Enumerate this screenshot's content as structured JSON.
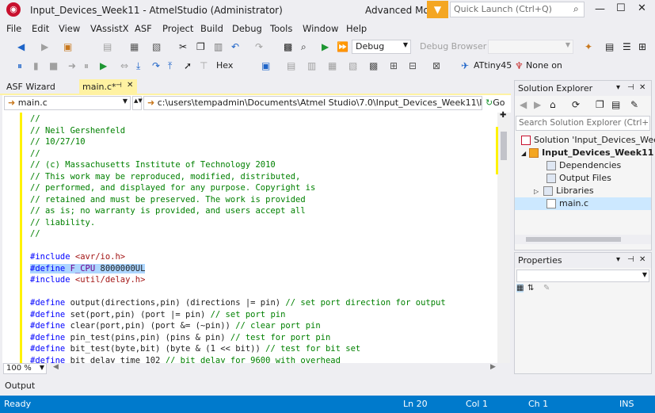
{
  "window": {
    "title": "Input_Devices_Week11 - AtmelStudio (Administrator)",
    "mode": "Advanced Mode",
    "quick_launch_placeholder": "Quick Launch (Ctrl+Q)"
  },
  "menu": [
    "File",
    "Edit",
    "View",
    "VAssistX",
    "ASF",
    "Project",
    "Build",
    "Debug",
    "Tools",
    "Window",
    "Help"
  ],
  "toolbar": {
    "config": "Debug",
    "debug_browser": "Debug Browser",
    "hex_label": "Hex",
    "device": "ATtiny45",
    "tool": "None on"
  },
  "tabs": {
    "asf_wizard": "ASF Wizard",
    "main": "main.c*"
  },
  "nav": {
    "file": "main.c",
    "path": "c:\\users\\tempadmin\\Documents\\Atmel Studio\\7.0\\Input_Devices_Week11\\Input_Devices",
    "go": "Go"
  },
  "code": [
    {
      "parts": [
        {
          "c": "cmt",
          "t": "//"
        }
      ]
    },
    {
      "parts": [
        {
          "c": "cmt",
          "t": "// Neil Gershenfeld"
        }
      ]
    },
    {
      "parts": [
        {
          "c": "cmt",
          "t": "// 10/27/10"
        }
      ]
    },
    {
      "parts": [
        {
          "c": "cmt",
          "t": "//"
        }
      ]
    },
    {
      "parts": [
        {
          "c": "cmt",
          "t": "// (c) Massachusetts Institute of Technology 2010"
        }
      ]
    },
    {
      "parts": [
        {
          "c": "cmt",
          "t": "// This work may be reproduced, modified, distributed,"
        }
      ]
    },
    {
      "parts": [
        {
          "c": "cmt",
          "t": "// performed, and displayed for any purpose. Copyright is"
        }
      ]
    },
    {
      "parts": [
        {
          "c": "cmt",
          "t": "// retained and must be preserved. The work is provided"
        }
      ]
    },
    {
      "parts": [
        {
          "c": "cmt",
          "t": "// as is; no warranty is provided, and users accept all"
        }
      ]
    },
    {
      "parts": [
        {
          "c": "cmt",
          "t": "// liability."
        }
      ]
    },
    {
      "parts": [
        {
          "c": "cmt",
          "t": "//"
        }
      ]
    },
    {
      "parts": [
        {
          "c": "",
          "t": ""
        }
      ]
    },
    {
      "parts": [
        {
          "c": "kw",
          "t": "#include "
        },
        {
          "c": "str",
          "t": "<avr/io.h>"
        }
      ]
    },
    {
      "parts": [
        {
          "c": "kw sel",
          "t": "#define "
        },
        {
          "c": "mac sel",
          "t": "F_CPU"
        },
        {
          "c": "sel",
          "t": " 8000000UL"
        }
      ]
    },
    {
      "parts": [
        {
          "c": "kw",
          "t": "#include "
        },
        {
          "c": "str",
          "t": "<util/delay.h>"
        }
      ]
    },
    {
      "parts": [
        {
          "c": "",
          "t": ""
        }
      ]
    },
    {
      "parts": [
        {
          "c": "kw",
          "t": "#define "
        },
        {
          "c": "",
          "t": "output(directions,pin) (directions |= pin) "
        },
        {
          "c": "cmt",
          "t": "// set port direction for output"
        }
      ]
    },
    {
      "parts": [
        {
          "c": "kw",
          "t": "#define "
        },
        {
          "c": "",
          "t": "set(port,pin) (port |= pin) "
        },
        {
          "c": "cmt",
          "t": "// set port pin"
        }
      ]
    },
    {
      "parts": [
        {
          "c": "kw",
          "t": "#define "
        },
        {
          "c": "",
          "t": "clear(port,pin) (port &= (~pin)) "
        },
        {
          "c": "cmt",
          "t": "// clear port pin"
        }
      ]
    },
    {
      "parts": [
        {
          "c": "kw",
          "t": "#define "
        },
        {
          "c": "",
          "t": "pin_test(pins,pin) (pins & pin) "
        },
        {
          "c": "cmt",
          "t": "// test for port pin"
        }
      ]
    },
    {
      "parts": [
        {
          "c": "kw",
          "t": "#define "
        },
        {
          "c": "",
          "t": "bit_test(byte,bit) (byte & (1 << bit)) "
        },
        {
          "c": "cmt",
          "t": "// test for bit set"
        }
      ]
    },
    {
      "parts": [
        {
          "c": "kw",
          "t": "#define "
        },
        {
          "c": "",
          "t": "bit_delay_time 102 "
        },
        {
          "c": "cmt",
          "t": "// bit delay for 9600 with overhead"
        }
      ]
    }
  ],
  "zoom": "100 %",
  "output_label": "Output",
  "status": {
    "ready": "Ready",
    "ln": "Ln 20",
    "col": "Col 1",
    "ch": "Ch 1",
    "ins": "INS"
  },
  "solution_explorer": {
    "title": "Solution Explorer",
    "search_placeholder": "Search Solution Explorer (Ctrl+",
    "items": [
      {
        "label": "Solution 'Input_Devices_Week11'"
      },
      {
        "label": "Input_Devices_Week11"
      },
      {
        "label": "Dependencies"
      },
      {
        "label": "Output Files"
      },
      {
        "label": "Libraries"
      },
      {
        "label": "main.c"
      }
    ]
  },
  "properties": {
    "title": "Properties"
  },
  "icons": {
    "logo": "atmel-logo-icon",
    "search": "search-icon",
    "funnel": "filter-icon"
  }
}
